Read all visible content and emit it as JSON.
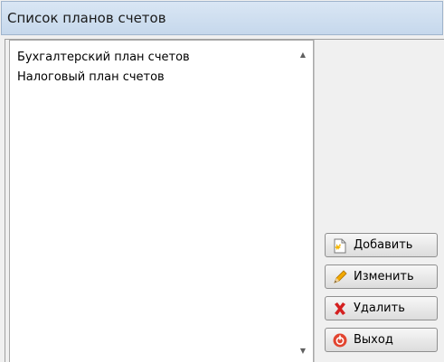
{
  "window": {
    "title": "Список планов счетов"
  },
  "list": {
    "items": [
      {
        "label": "Бухгалтерский план счетов"
      },
      {
        "label": "Налоговый план счетов"
      }
    ]
  },
  "buttons": {
    "add": {
      "label": "Добавить",
      "icon": "add-document-icon"
    },
    "edit": {
      "label": "Изменить",
      "icon": "pencil-icon"
    },
    "delete": {
      "label": "Удалить",
      "icon": "red-x-icon"
    },
    "exit": {
      "label": "Выход",
      "icon": "power-exit-icon"
    }
  },
  "colors": {
    "titlebar": "#d2e1f2",
    "delete_icon": "#d42020",
    "exit_icon": "#e2442f"
  }
}
